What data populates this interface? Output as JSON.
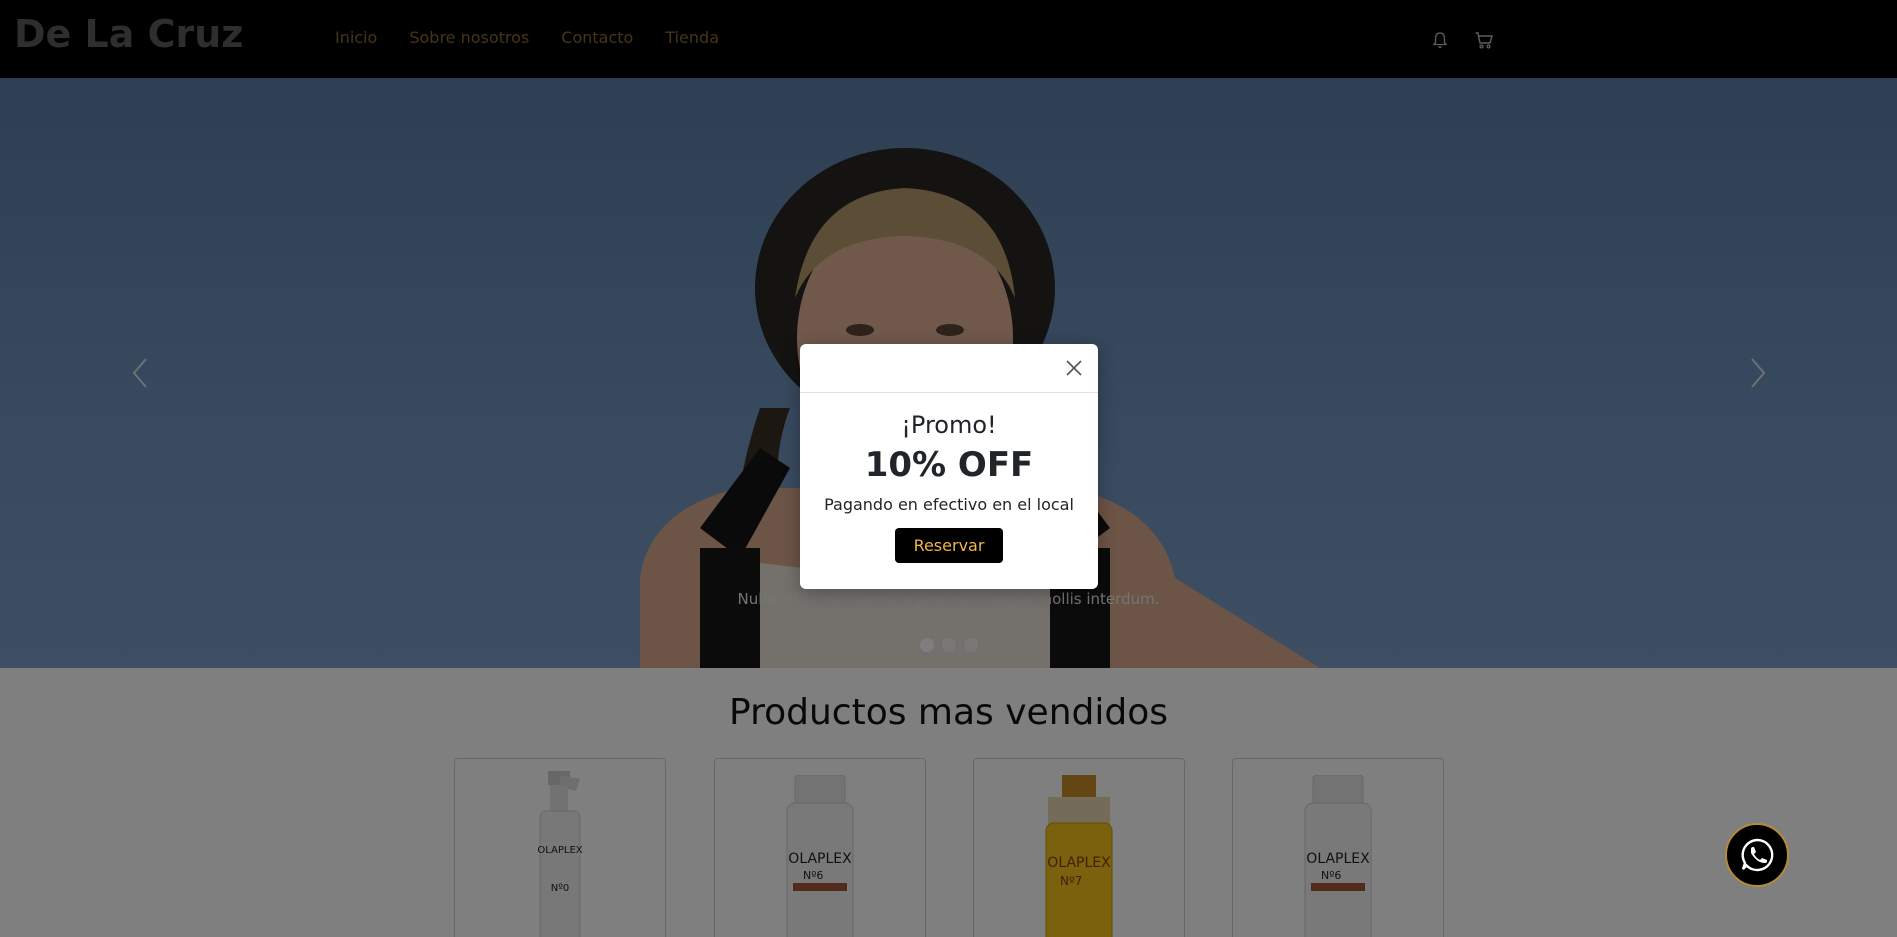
{
  "navbar": {
    "brand": "De La Cruz",
    "links": [
      "Inicio",
      "Sobre nosotros",
      "Contacto",
      "Tienda"
    ],
    "icons": [
      "bell-icon",
      "cart-icon"
    ]
  },
  "hero": {
    "caption": "Nulla vitae elit libero, a pharetra augue mollis interdum.",
    "slides_count": 3,
    "active_slide": 1,
    "prev_icon": "chevron-left-icon",
    "next_icon": "chevron-right-icon"
  },
  "products": {
    "title": "Productos mas vendidos",
    "items": [
      {
        "brand": "OLAPLEX",
        "number": "Nº0"
      },
      {
        "brand": "OLAPLEX",
        "number": "Nº6"
      },
      {
        "brand": "OLAPLEX",
        "number": "Nº7"
      },
      {
        "brand": "OLAPLEX",
        "number": "Nº6"
      }
    ]
  },
  "modal": {
    "title": "¡Promo!",
    "discount": "10% OFF",
    "subtitle": "Pagando en efectivo en el local",
    "button": "Reservar",
    "close_icon": "close-icon"
  },
  "whatsapp": {
    "icon": "whatsapp-icon"
  },
  "colors": {
    "navbar_bg": "#000000",
    "nav_link": "#8a6a2e",
    "brand": "#5c5c5c",
    "button_text": "#f0b54a",
    "whatsapp_border": "#b58a3a"
  }
}
